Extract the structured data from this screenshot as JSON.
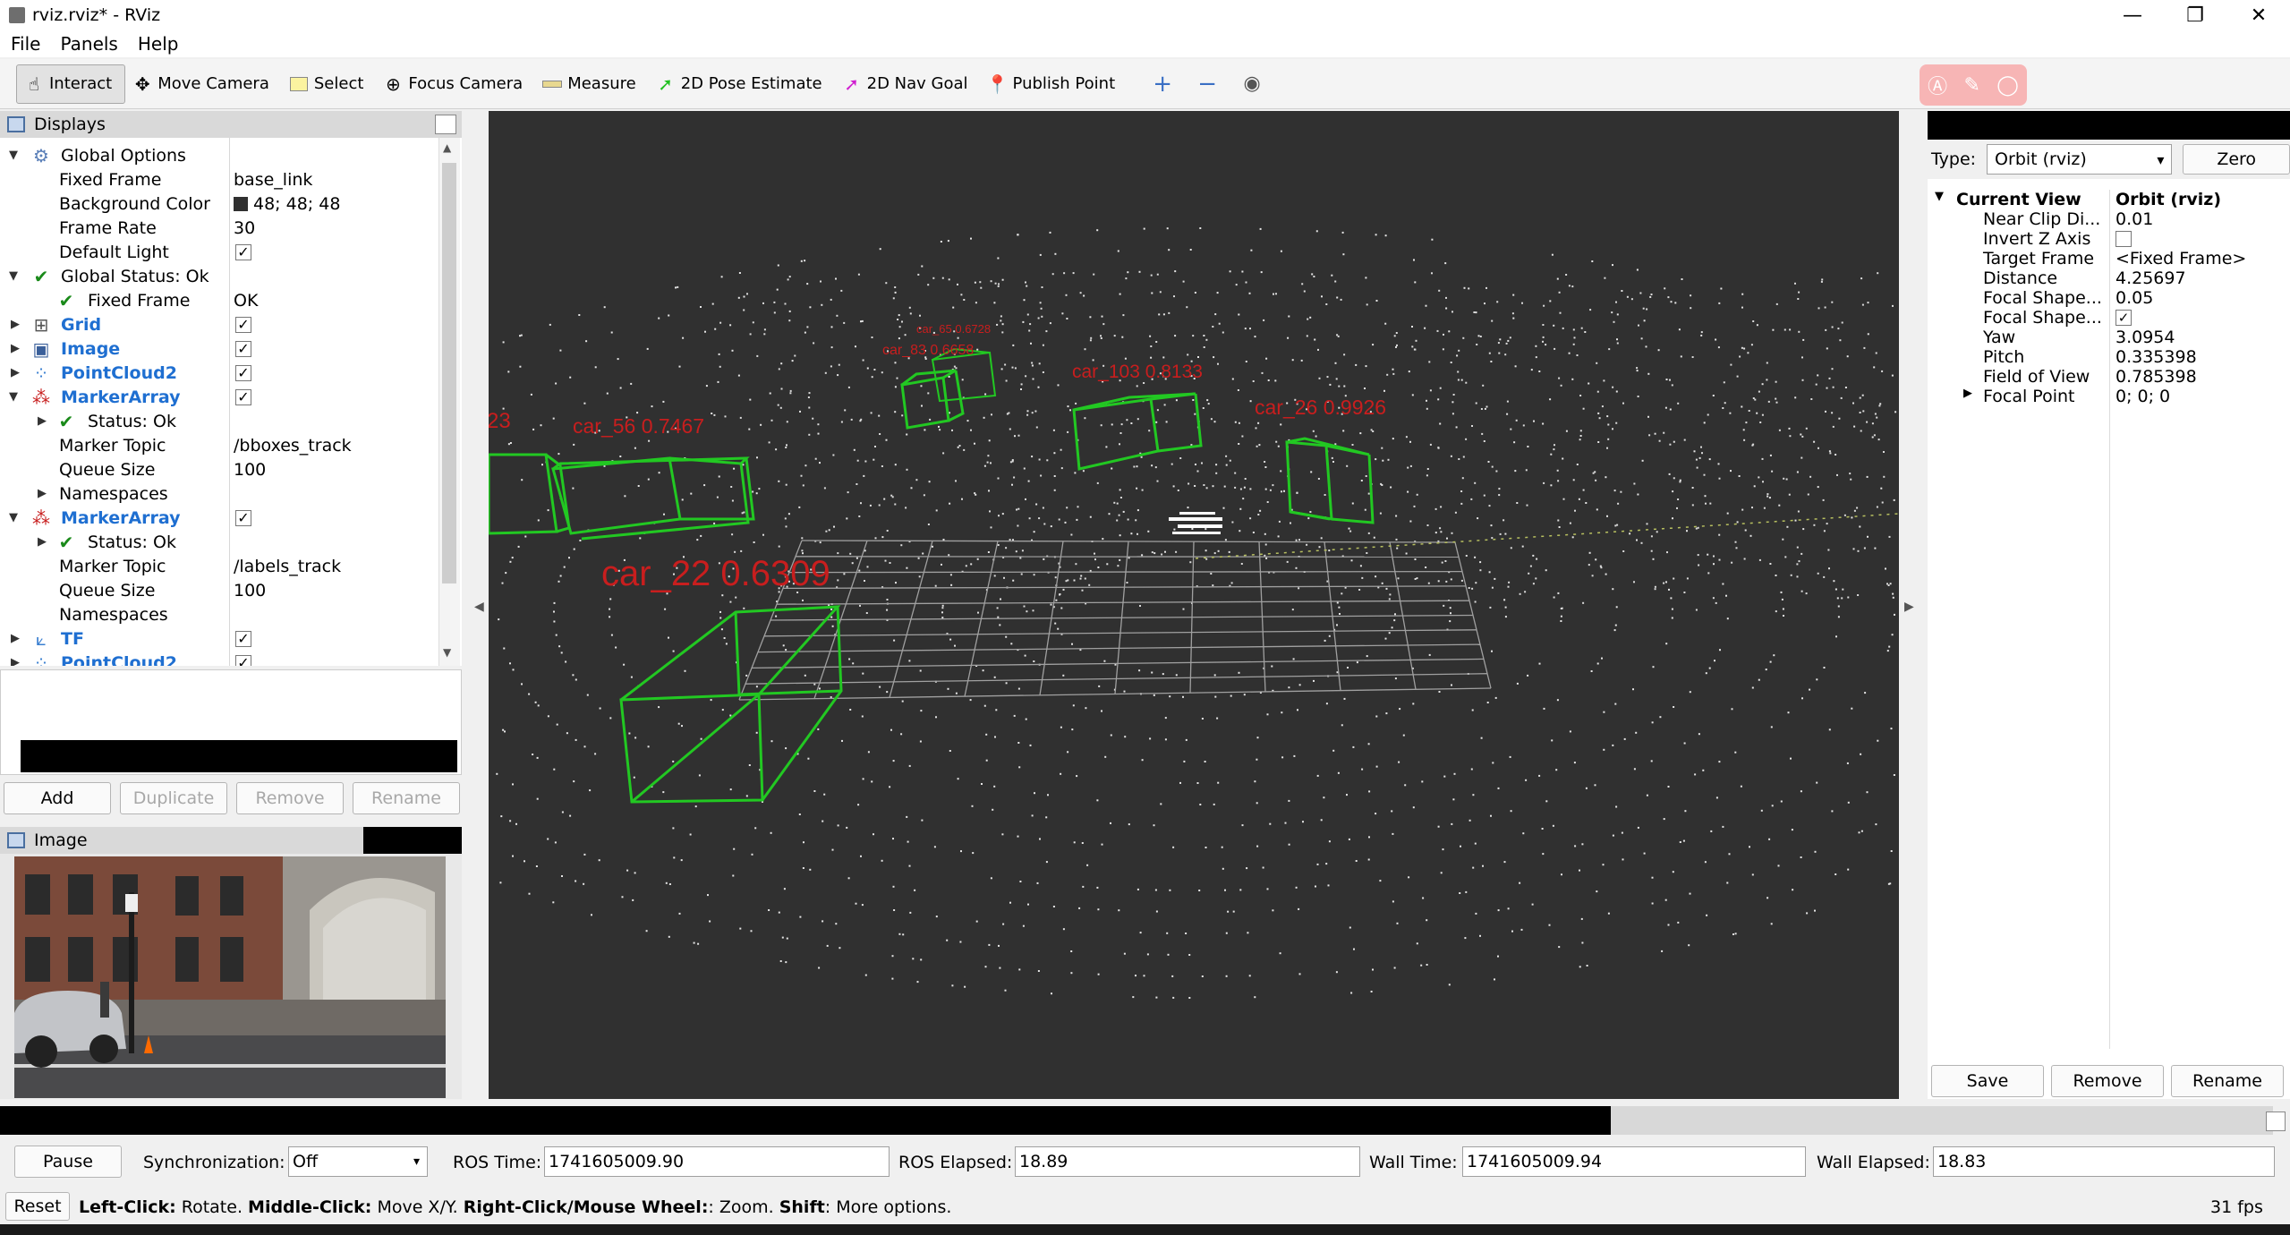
{
  "window": {
    "title": "rviz.rviz* - RViz"
  },
  "menu": {
    "file": "File",
    "panels": "Panels",
    "help": "Help"
  },
  "toolbar": {
    "interact": "Interact",
    "move_camera": "Move Camera",
    "select": "Select",
    "focus_camera": "Focus Camera",
    "measure": "Measure",
    "pose_estimate": "2D Pose Estimate",
    "nav_goal": "2D Nav Goal",
    "publish_point": "Publish Point"
  },
  "displays": {
    "title": "Displays",
    "rows": {
      "global_options": "Global Options",
      "fixed_frame": "Fixed Frame",
      "fixed_frame_val": "base_link",
      "bg_color": "Background Color",
      "bg_color_val": "48; 48; 48",
      "frame_rate": "Frame Rate",
      "frame_rate_val": "30",
      "default_light": "Default Light",
      "global_status": "Global Status: Ok",
      "fixed_frame_status": "Fixed Frame",
      "fixed_frame_status_val": "OK",
      "grid": "Grid",
      "image": "Image",
      "pointcloud2": "PointCloud2",
      "markerarray1": "MarkerArray",
      "status_ok1": "Status: Ok",
      "marker_topic1": "Marker Topic",
      "marker_topic1_val": "/bboxes_track",
      "queue_size1": "Queue Size",
      "queue_size1_val": "100",
      "namespaces1": "Namespaces",
      "markerarray2": "MarkerArray",
      "status_ok2": "Status: Ok",
      "marker_topic2": "Marker Topic",
      "marker_topic2_val": "/labels_track",
      "queue_size2": "Queue Size",
      "queue_size2_val": "100",
      "namespaces2": "Namespaces",
      "tf": "TF",
      "pointcloud2b": "PointCloud2"
    },
    "check": "✓",
    "buttons": {
      "add": "Add",
      "duplicate": "Duplicate",
      "remove": "Remove",
      "rename": "Rename"
    }
  },
  "image_panel": {
    "title": "Image"
  },
  "viewport": {
    "labels": {
      "car_23_partial": "23",
      "car_56": "car_56  0.7467",
      "car_65": "car_65  0.6728",
      "car_83": "car_83  0.6658",
      "car_103": "car_103  0.8133",
      "car_26": "car_26  0.9926",
      "car_22": "car_22  0.6309"
    },
    "background_color": "#303030",
    "box_color": "#22c822",
    "label_color": "#c81e1e"
  },
  "views": {
    "type_label": "Type:",
    "type_value": "Orbit (rviz)",
    "zero": "Zero",
    "current_view": "Current View",
    "current_view_val": "Orbit (rviz)",
    "props": [
      {
        "name": "Near Clip Di...",
        "value": "0.01"
      },
      {
        "name": "Invert Z Axis",
        "value": ""
      },
      {
        "name": "Target Frame",
        "value": "<Fixed Frame>"
      },
      {
        "name": "Distance",
        "value": "4.25697"
      },
      {
        "name": "Focal Shape...",
        "value": "0.05"
      },
      {
        "name": "Focal Shape...",
        "value": "✓"
      },
      {
        "name": "Yaw",
        "value": "3.0954"
      },
      {
        "name": "Pitch",
        "value": "0.335398"
      },
      {
        "name": "Field of View",
        "value": "0.785398"
      },
      {
        "name": "Focal Point",
        "value": "0; 0; 0"
      }
    ],
    "buttons": {
      "save": "Save",
      "remove": "Remove",
      "rename": "Rename"
    }
  },
  "time": {
    "pause": "Pause",
    "sync_label": "Synchronization:",
    "sync_value": "Off",
    "ros_time_label": "ROS Time:",
    "ros_time": "1741605009.90",
    "ros_elapsed_label": "ROS Elapsed:",
    "ros_elapsed": "18.89",
    "wall_time_label": "Wall Time:",
    "wall_time": "1741605009.94",
    "wall_elapsed_label": "Wall Elapsed:",
    "wall_elapsed": "18.83"
  },
  "status": {
    "reset": "Reset",
    "left_click": "Left-Click:",
    "left_click_desc": " Rotate. ",
    "middle_click": "Middle-Click:",
    "middle_click_desc": " Move X/Y. ",
    "right_click": "Right-Click/Mouse Wheel:",
    "right_click_desc": ": Zoom. ",
    "shift": "Shift",
    "shift_desc": ": More options.",
    "fps": "31 fps"
  }
}
